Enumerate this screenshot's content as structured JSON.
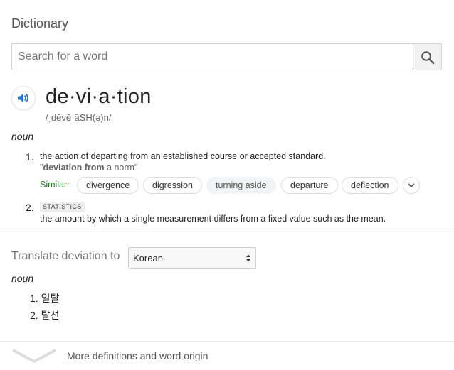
{
  "header": {
    "title": "Dictionary"
  },
  "search": {
    "placeholder": "Search for a word",
    "value": ""
  },
  "entry": {
    "word": "de·vi·a·tion",
    "phonetic": "/ˌdēvēˈāSH(ə)n/",
    "part_of_speech": "noun",
    "senses": [
      {
        "number": "1.",
        "definition": "the action of departing from an established course or accepted standard.",
        "example_open": "\"",
        "example_bold": "deviation from",
        "example_rest": " a norm\"",
        "similar_label": "Similar:",
        "similar": [
          "divergence",
          "digression",
          "turning aside",
          "departure",
          "deflection"
        ]
      },
      {
        "number": "2.",
        "label": "STATISTICS",
        "definition": "the amount by which a single measurement differs from a fixed value such as the mean."
      }
    ]
  },
  "translate": {
    "label": "Translate deviation to",
    "selected_language": "Korean",
    "part_of_speech": "noun",
    "results": [
      {
        "number": "1.",
        "text": "일탈"
      },
      {
        "number": "2.",
        "text": "탈선"
      }
    ]
  },
  "footer": {
    "more_label": "More definitions and word origin"
  },
  "colors": {
    "similar_label": "#1a7a1a",
    "speaker_icon": "#1a73e8",
    "text": "#222222",
    "muted": "#777777"
  },
  "icons": {
    "search": "search-icon",
    "speaker": "speaker-icon",
    "expand": "chevron-down-icon"
  }
}
